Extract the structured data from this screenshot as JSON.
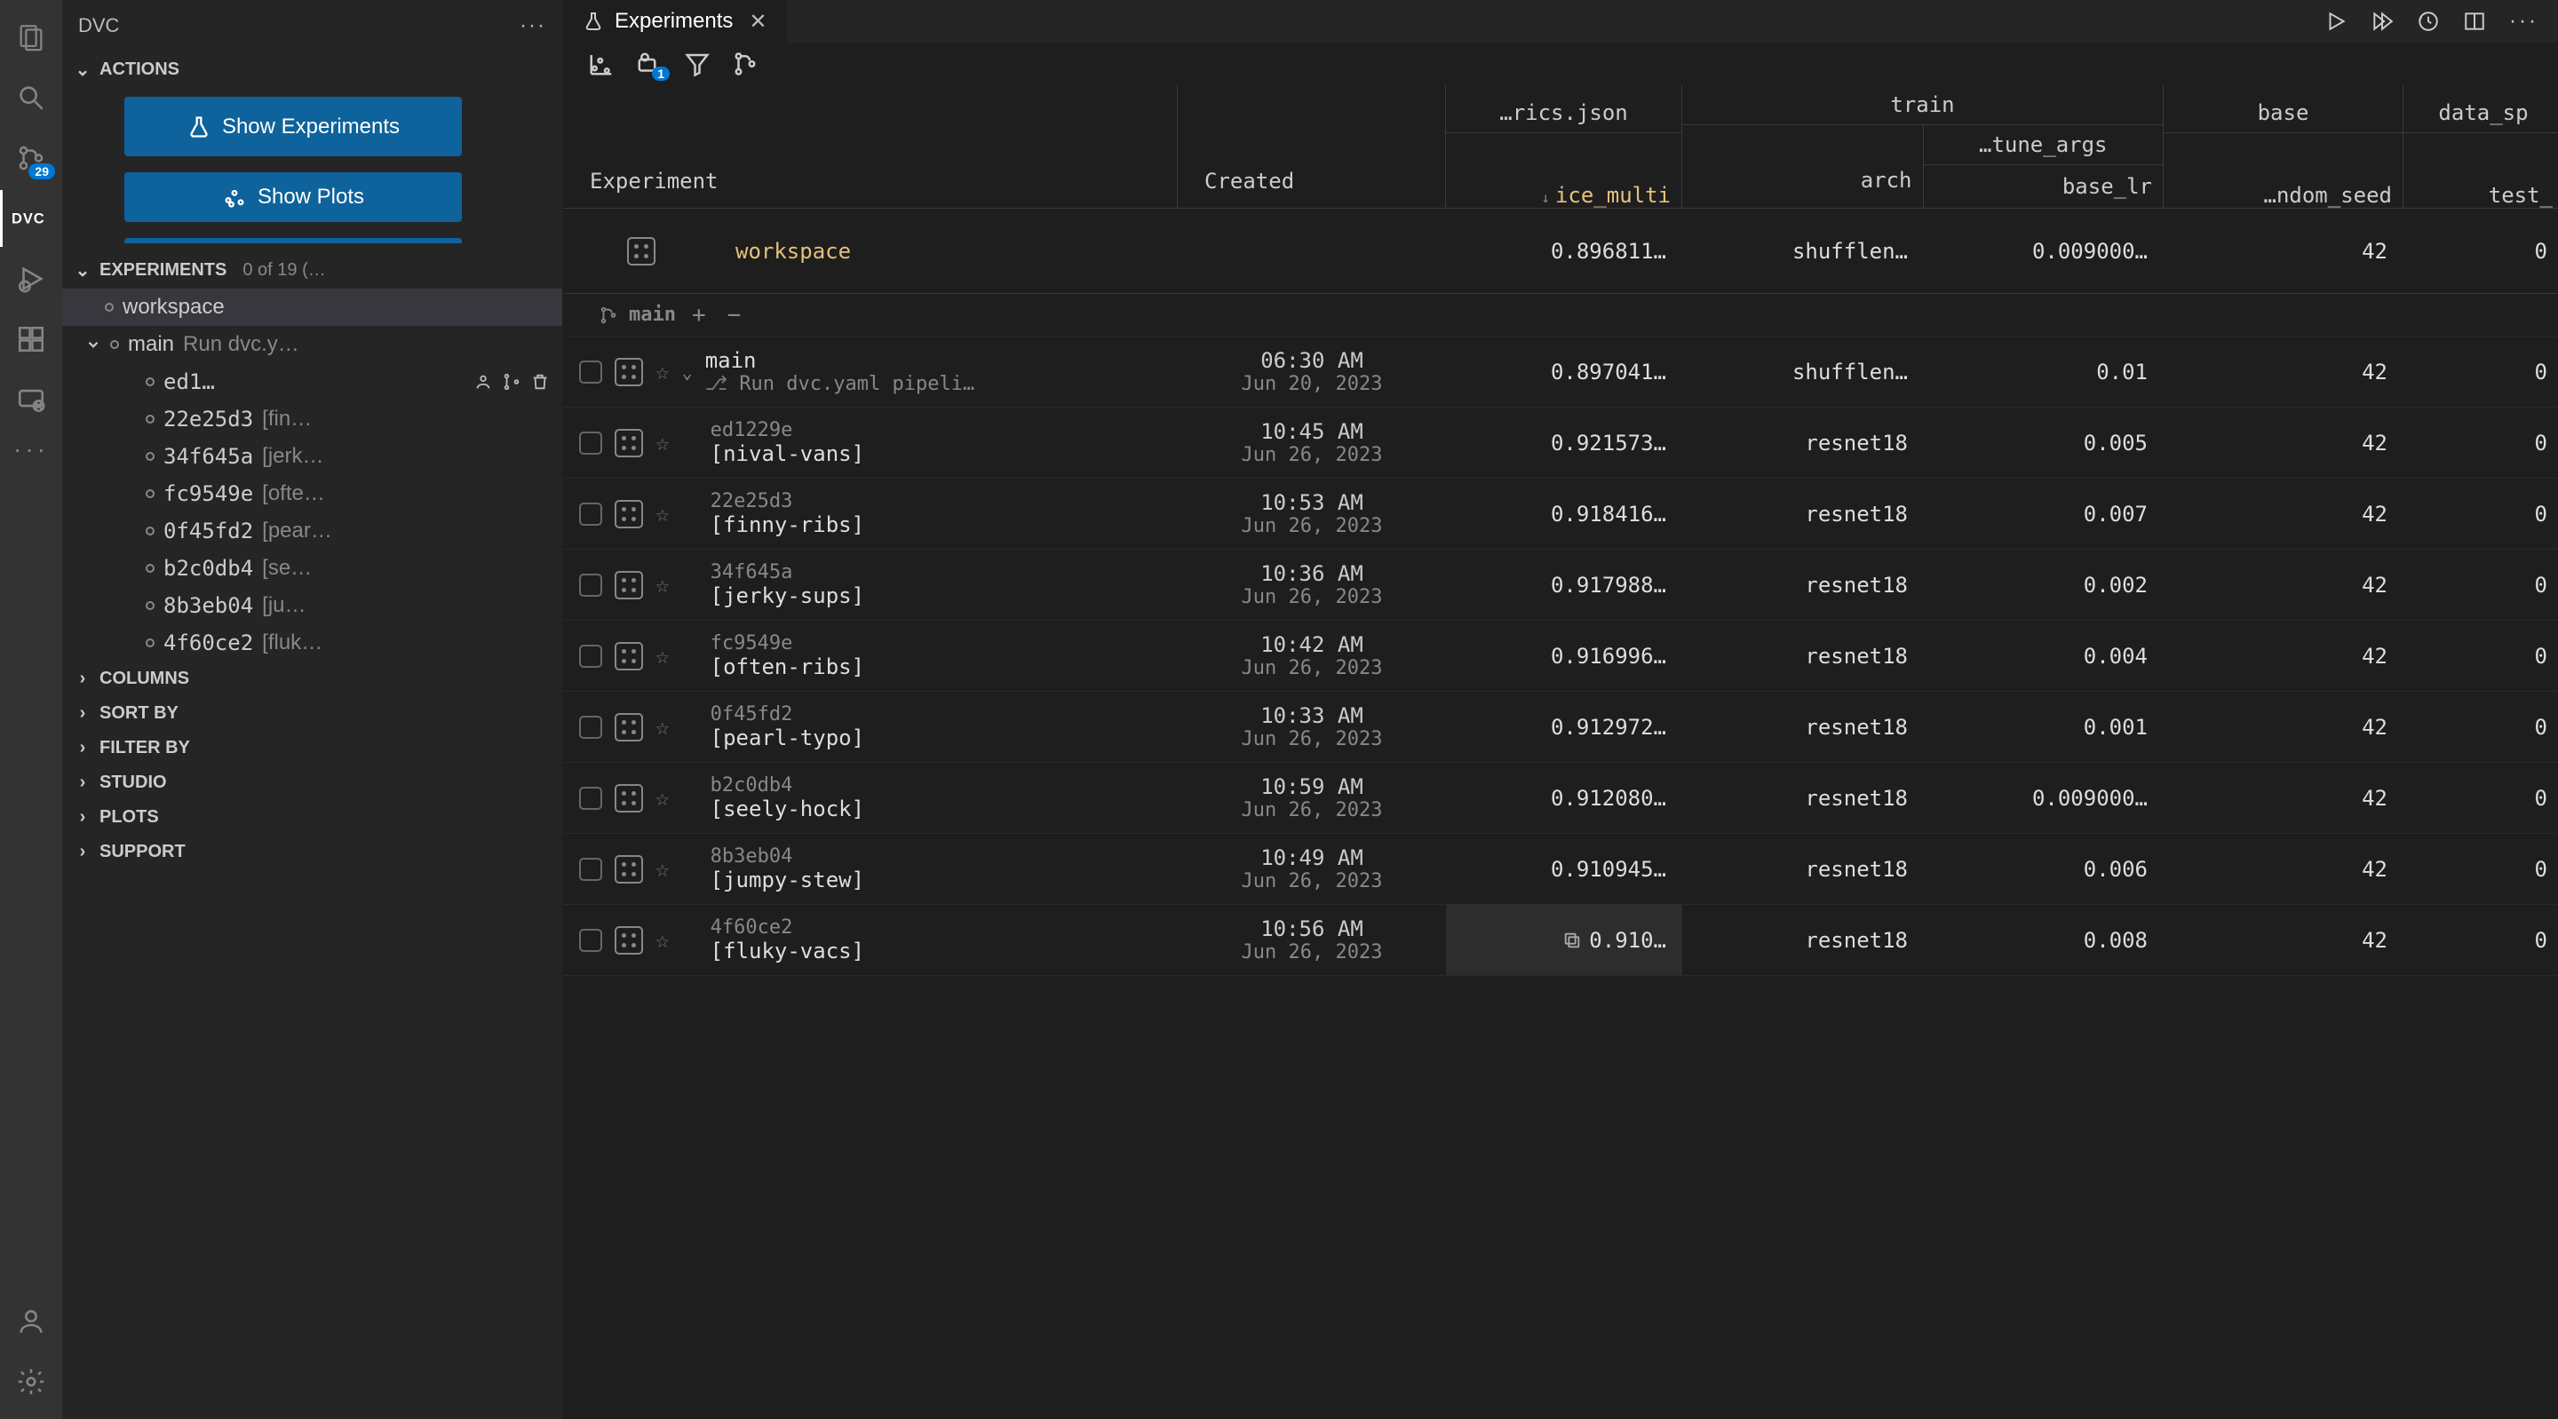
{
  "activity": {
    "source_badge": "29"
  },
  "sidebar": {
    "title": "DVC",
    "actions": {
      "header": "ACTIONS",
      "show_experiments": "Show Experiments",
      "show_plots": "Show Plots"
    },
    "experiments": {
      "header": "EXPERIMENTS",
      "meta": "0 of 19 (…",
      "workspace": "workspace",
      "main": "main",
      "main_sub": "Run dvc.y…",
      "items": [
        {
          "sha": "ed1…",
          "sub": ""
        },
        {
          "sha": "22e25d3",
          "sub": "[fin…"
        },
        {
          "sha": "34f645a",
          "sub": "[jerk…"
        },
        {
          "sha": "fc9549e",
          "sub": "[ofte…"
        },
        {
          "sha": "0f45fd2",
          "sub": "[pear…"
        },
        {
          "sha": "b2c0db4",
          "sub": "[se…"
        },
        {
          "sha": "8b3eb04",
          "sub": "[ju…"
        },
        {
          "sha": "4f60ce2",
          "sub": "[fluk…"
        }
      ]
    },
    "columns": "COLUMNS",
    "sortby": "SORT BY",
    "filterby": "FILTER BY",
    "studio": "STUDIO",
    "plots": "PLOTS",
    "support": "SUPPORT"
  },
  "tab": {
    "label": "Experiments"
  },
  "toolbar": {
    "filter_badge": "1"
  },
  "table": {
    "headers": {
      "experiment": "Experiment",
      "created": "Created",
      "metrics_file": "…rics.json",
      "metric": "ice_multi",
      "train": "train",
      "arch": "arch",
      "tune_args": "…tune_args",
      "base_lr": "base_lr",
      "base": "base",
      "random_seed": "…ndom_seed",
      "data_sp": "data_sp",
      "test": "test_"
    },
    "workspace": {
      "name": "workspace",
      "metric": "0.896811…",
      "arch": "shufflen…",
      "lr": "0.009000…",
      "seed": "42",
      "test": "0"
    },
    "branch": "main",
    "rows": [
      {
        "sha": "",
        "name": "main",
        "sub": "Run dvc.yaml pipeli…",
        "branch_icon": true,
        "time": "06:30 AM",
        "date": "Jun 20, 2023",
        "metric": "0.897041…",
        "arch": "shufflen…",
        "lr": "0.01",
        "seed": "42",
        "test": "0"
      },
      {
        "sha": "ed1229e",
        "name": "[nival-vans]",
        "time": "10:45 AM",
        "date": "Jun 26, 2023",
        "metric": "0.921573…",
        "arch": "resnet18",
        "lr": "0.005",
        "seed": "42",
        "test": "0"
      },
      {
        "sha": "22e25d3",
        "name": "[finny-ribs]",
        "time": "10:53 AM",
        "date": "Jun 26, 2023",
        "metric": "0.918416…",
        "arch": "resnet18",
        "lr": "0.007",
        "seed": "42",
        "test": "0"
      },
      {
        "sha": "34f645a",
        "name": "[jerky-sups]",
        "time": "10:36 AM",
        "date": "Jun 26, 2023",
        "metric": "0.917988…",
        "arch": "resnet18",
        "lr": "0.002",
        "seed": "42",
        "test": "0"
      },
      {
        "sha": "fc9549e",
        "name": "[often-ribs]",
        "time": "10:42 AM",
        "date": "Jun 26, 2023",
        "metric": "0.916996…",
        "arch": "resnet18",
        "lr": "0.004",
        "seed": "42",
        "test": "0"
      },
      {
        "sha": "0f45fd2",
        "name": "[pearl-typo]",
        "time": "10:33 AM",
        "date": "Jun 26, 2023",
        "metric": "0.912972…",
        "arch": "resnet18",
        "lr": "0.001",
        "seed": "42",
        "test": "0"
      },
      {
        "sha": "b2c0db4",
        "name": "[seely-hock]",
        "time": "10:59 AM",
        "date": "Jun 26, 2023",
        "metric": "0.912080…",
        "arch": "resnet18",
        "lr": "0.009000…",
        "seed": "42",
        "test": "0"
      },
      {
        "sha": "8b3eb04",
        "name": "[jumpy-stew]",
        "time": "10:49 AM",
        "date": "Jun 26, 2023",
        "metric": "0.910945…",
        "arch": "resnet18",
        "lr": "0.006",
        "seed": "42",
        "test": "0"
      },
      {
        "sha": "4f60ce2",
        "name": "[fluky-vacs]",
        "time": "10:56 AM",
        "date": "Jun 26, 2023",
        "metric": "0.910…",
        "arch": "resnet18",
        "lr": "0.008",
        "seed": "42",
        "test": "0",
        "hover": true
      }
    ]
  }
}
